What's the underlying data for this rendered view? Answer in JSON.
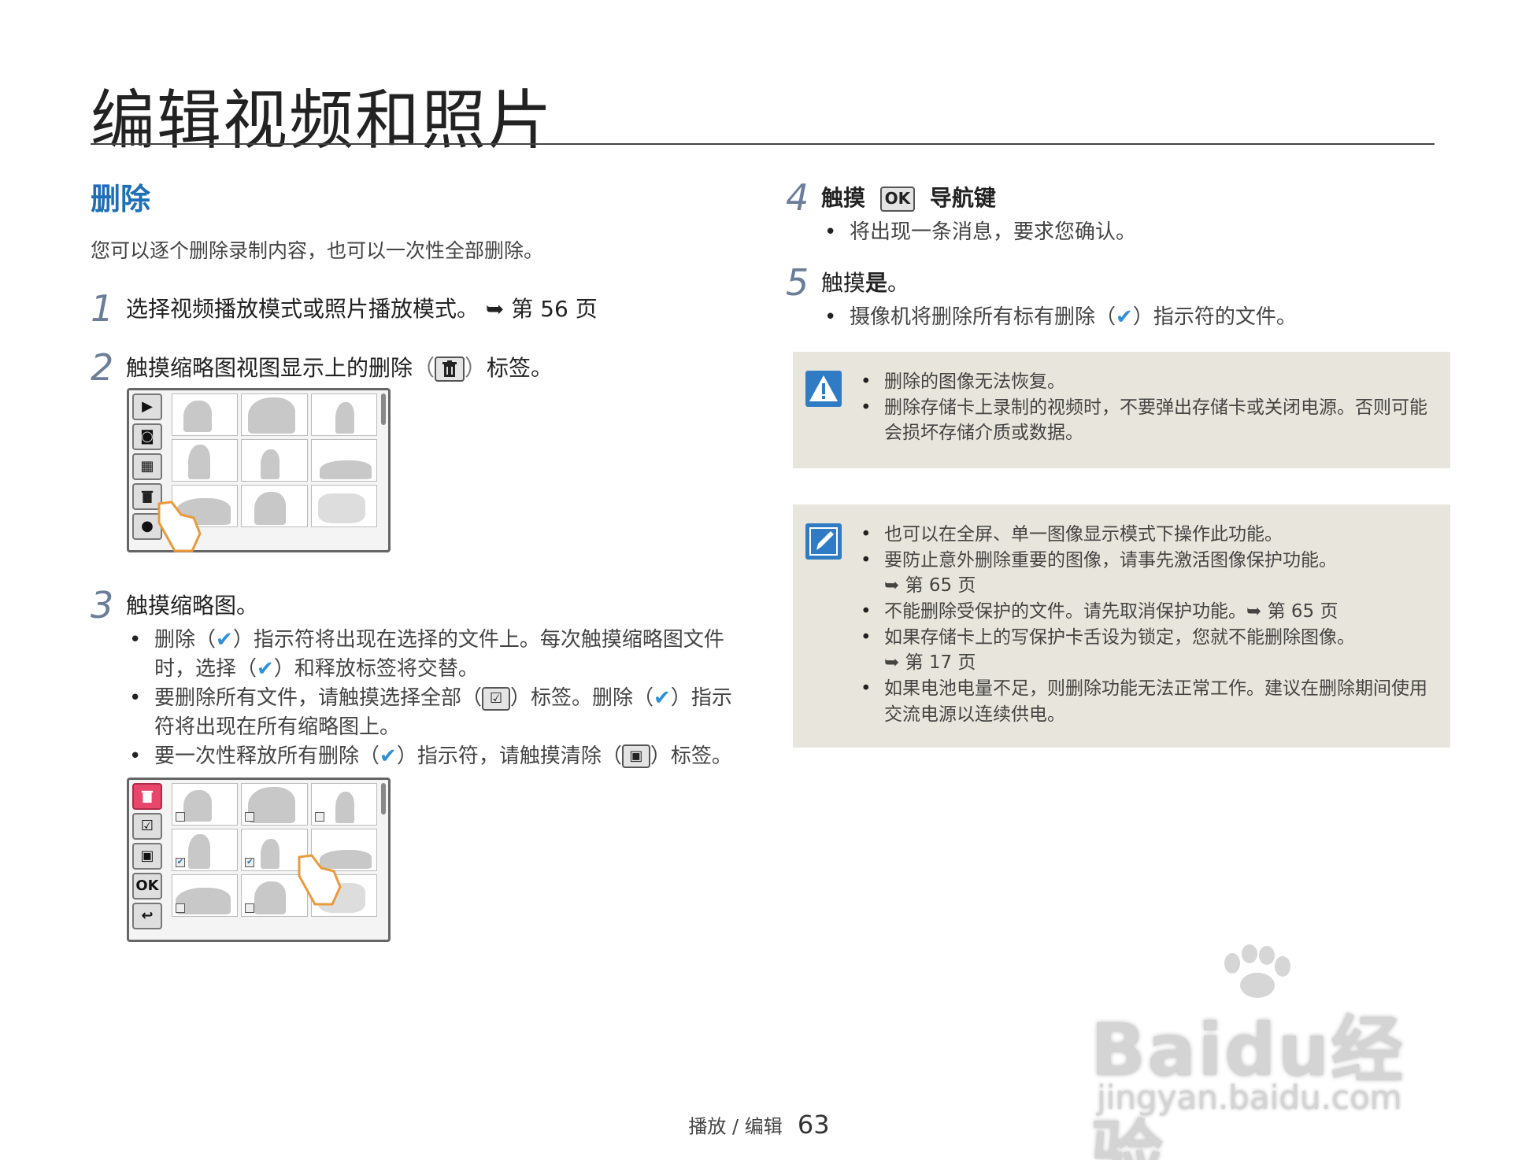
{
  "page": {
    "title": "编辑视频和照片",
    "footer_section": "播放 / 编辑",
    "page_number": "63"
  },
  "section": {
    "heading": "删除",
    "intro": "您可以逐个删除录制内容，也可以一次性全部删除。"
  },
  "steps": [
    {
      "num": "1",
      "text": "选择视频播放模式或照片播放模式。",
      "ref": "➥ 第 56 页"
    },
    {
      "num": "2",
      "text_before": "触摸缩略图视图显示上的删除",
      "text_after": "标签。"
    },
    {
      "num": "3",
      "text": "触摸缩略图。",
      "bullets": [
        {
          "a": "删除（",
          "b": "）指示符将出现在选择的文件上。每次触摸缩略图文件时，选择（",
          "c": "）和释放标签将交替。"
        },
        {
          "a": "要删除所有文件，请触摸选择全部（",
          "b": "）标签。删除（",
          "c": "）指示符将出现在所有缩略图上。"
        },
        {
          "a": "要一次性释放所有删除（",
          "b": "）指示符，请触摸清除（",
          "c": "）标签。"
        }
      ]
    },
    {
      "num": "4",
      "text_before": "触摸",
      "icon": "OK",
      "text_after": "导航键",
      "bullets": [
        "将出现一条消息，要求您确认。"
      ]
    },
    {
      "num": "5",
      "text_before": "触摸",
      "bold": "是",
      "text_after": "。",
      "bullet": {
        "a": "摄像机将删除所有标有删除（",
        "b": "）指示符的文件。"
      }
    }
  ],
  "warning": {
    "icon": "warning-triangle-icon",
    "items": [
      "删除的图像无法恢复。",
      "删除存储卡上录制的视频时，不要弹出存储卡或关闭电源。否则可能会损坏存储介质或数据。"
    ]
  },
  "note": {
    "icon": "note-pencil-icon",
    "items": [
      "也可以在全屏、单一图像显示模式下操作此功能。",
      "要防止意外删除重要的图像，请事先激活图像保护功能。",
      "➥ 第 65 页",
      "不能删除受保护的文件。请先取消保护功能。➥ 第 65 页",
      "如果存储卡上的写保护卡舌设为锁定，您就不能删除图像。",
      "➥ 第 17 页",
      "如果电池电量不足，则删除功能无法正常工作。建议在删除期间使用交流电源以连续供电。"
    ]
  },
  "screen2_buttons": [
    "OK",
    "↩"
  ],
  "watermark": {
    "line1": "Baidu经验",
    "line2": "jingyan.baidu.com"
  },
  "colors": {
    "heading_blue": "#1f6fb7",
    "note_bg": "#e8e6dc",
    "delete_red": "#e8466a",
    "check_blue": "#2f8fd8"
  }
}
